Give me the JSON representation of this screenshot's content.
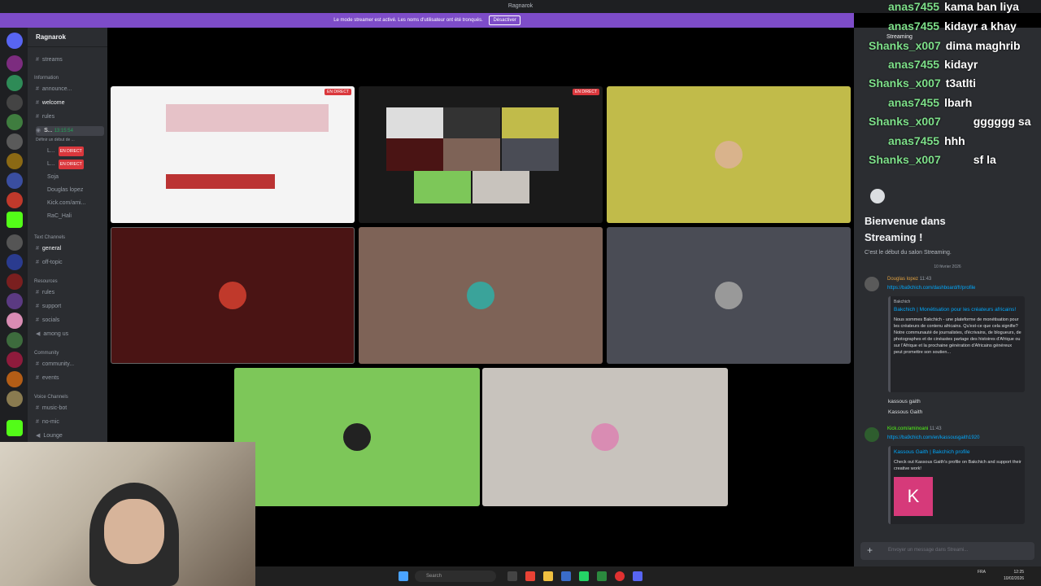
{
  "window": {
    "title": "Ragnarok"
  },
  "banner": {
    "text": "Le mode streamer est activé. Les noms d'utilisateur ont été tronqués.",
    "button": "Désactiver"
  },
  "server": {
    "name": "Ragnarok"
  },
  "channels": {
    "streams": "streams",
    "cat_information": "Information",
    "announce": "announce...",
    "welcome": "welcome",
    "rules": "rules",
    "stream_channel": "S...",
    "stream_time": "13:15:54",
    "stream_sub": "Définir un début de ...",
    "users": [
      {
        "name": "L...",
        "badge": "EN DIRECT"
      },
      {
        "name": "L...",
        "badge": "EN DIRECT"
      },
      {
        "name": "Soja"
      },
      {
        "name": "Douglas lopez"
      },
      {
        "name": "Kick.com/ami..."
      },
      {
        "name": "RaC_Hali"
      }
    ],
    "cat_text": "Text Channels",
    "general": "general",
    "off_topic": "off-topic",
    "cat_resources": "Resources",
    "rules2": "rules",
    "support": "support",
    "socials": "socials",
    "among_us": "among us",
    "cat_community": "Community",
    "community": "community...",
    "events": "events",
    "cat_voice": "Voice Channels",
    "music_bot": "music-bot",
    "no_mic": "no-mic",
    "lounge": "Lounge"
  },
  "stage": {
    "tiles": [
      {
        "badge": "EN DIRECT",
        "color": "#f4f4f4"
      },
      {
        "badge": "EN DIRECT",
        "color": "#1a1a1a"
      },
      {
        "color": "#c1bb4a"
      },
      {
        "color": "#4a1414"
      },
      {
        "color": "#7e6357"
      },
      {
        "color": "#4a4c55"
      },
      {
        "color": "#7dc759"
      },
      {
        "color": "#c8c3bd"
      }
    ]
  },
  "overlay_chat": [
    {
      "user": "anas7455",
      "msg": "kama ban liya"
    },
    {
      "user": "anas7455",
      "msg": "kidayr a khay"
    },
    {
      "user": "Shanks_x007",
      "msg": "dima maghrib"
    },
    {
      "user": "anas7455",
      "msg": "kidayr"
    },
    {
      "user": "Shanks_x007",
      "msg": "t3atlti"
    },
    {
      "user": "anas7455",
      "msg": "lbarh"
    },
    {
      "user": "Shanks_x007",
      "msg": "gggggg sa"
    },
    {
      "user": "anas7455",
      "msg": "hhh"
    },
    {
      "user": "Shanks_x007",
      "msg": "sf la"
    }
  ],
  "chat": {
    "header": "Streaming",
    "welcome_line1": "Bienvenue dans",
    "welcome_line2": "Streaming !",
    "welcome_sub": "C'est le début du salon Streaming.",
    "date": "10 février 2026",
    "msg1_user": "Douglas lopez",
    "msg1_time": "11:43",
    "msg1_link": "https://ba9chich.com/dashboard/fr/profile",
    "embed1_site": "Bakchich",
    "embed1_title": "Bakchich | Monétisation pour les créateurs africains!",
    "embed1_desc": "Nous sommes Bakchich - une plateforme de monétisation pour les créateurs de contenu africains. Qu'est-ce que cela signifie? Notre communauté de journalistes, d'écrivains, de blogueurs, de photographes et de cinéastes partage des histoires d'Afrique ou sur l'Afrique et la prochaine génération d'Africains généreux peut promettre son soutien...",
    "line_a": "kassous gaith",
    "line_b": "Kassous Gaith",
    "msg2_user": "Kick.com/aminoani",
    "msg2_time": "11:43",
    "msg2_link": "https://ba9chich.com/en/kassousgaith1920",
    "embed2_title": "Kassous Gaith | Bakchich profile",
    "embed2_desc": "Check out Kassous Gaith's profile on Bakchich and support their creative work!",
    "embed2_letter": "K",
    "input_placeholder": "Envoyer un message dans Streami..."
  },
  "taskbar": {
    "search": "Search",
    "lang": "FRA",
    "time": "12:25",
    "date": "10/02/2026"
  }
}
